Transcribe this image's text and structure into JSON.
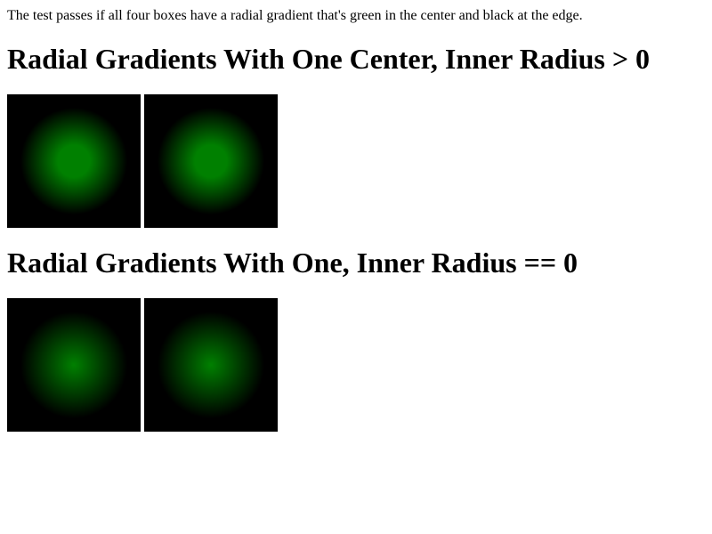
{
  "intro": "The test passes if all four boxes have a radial gradient that's green in the center and black at the edge.",
  "sections": [
    {
      "heading": "Radial Gradients With One Center, Inner Radius > 0",
      "boxes": 2
    },
    {
      "heading": "Radial Gradients With One, Inner Radius == 0",
      "boxes": 2
    }
  ],
  "colors": {
    "center": "#008000",
    "edge": "#000000"
  }
}
